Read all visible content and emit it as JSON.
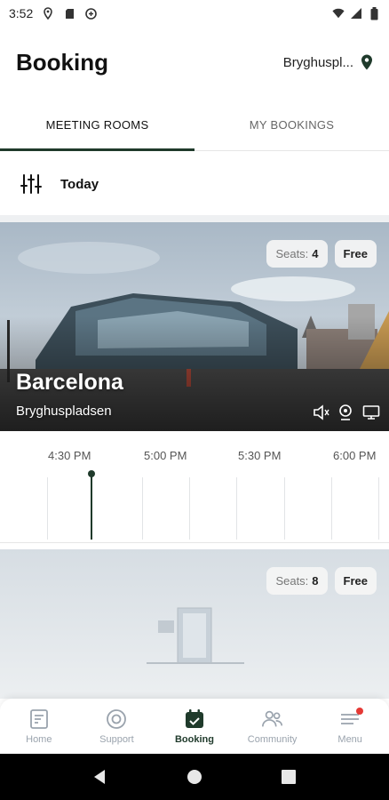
{
  "status_bar": {
    "time": "3:52",
    "icons_left": [
      "location-icon",
      "sd-card-icon",
      "sync-icon"
    ],
    "icons_right": [
      "wifi-icon",
      "signal-icon",
      "battery-icon"
    ]
  },
  "header": {
    "title": "Booking",
    "location": "Bryghuspl...",
    "location_icon": "pin-icon"
  },
  "tabs": [
    {
      "label": "MEETING ROOMS",
      "active": true
    },
    {
      "label": "MY BOOKINGS",
      "active": false
    }
  ],
  "filter": {
    "icon": "sliders-icon",
    "label": "Today"
  },
  "rooms": [
    {
      "name": "Barcelona",
      "location": "Bryghuspladsen",
      "seats_label": "Seats:",
      "seats": "4",
      "status": "Free",
      "amenities": [
        "speaker-icon",
        "webcam-icon",
        "monitor-icon"
      ]
    },
    {
      "name": "",
      "location": "",
      "seats_label": "Seats:",
      "seats": "8",
      "status": "Free",
      "amenities": []
    }
  ],
  "timeline": {
    "labels": [
      "4:30 PM",
      "5:00 PM",
      "5:30 PM",
      "6:00 PM"
    ]
  },
  "bottom_nav": [
    {
      "label": "Home",
      "icon": "home-icon",
      "active": false
    },
    {
      "label": "Support",
      "icon": "support-icon",
      "active": false
    },
    {
      "label": "Booking",
      "icon": "calendar-check-icon",
      "active": true
    },
    {
      "label": "Community",
      "icon": "community-icon",
      "active": false
    },
    {
      "label": "Menu",
      "icon": "menu-icon",
      "active": false,
      "notification": true
    }
  ],
  "colors": {
    "accent": "#1f3a2b",
    "inactive": "#9aa3ad",
    "notification": "#e53935"
  }
}
